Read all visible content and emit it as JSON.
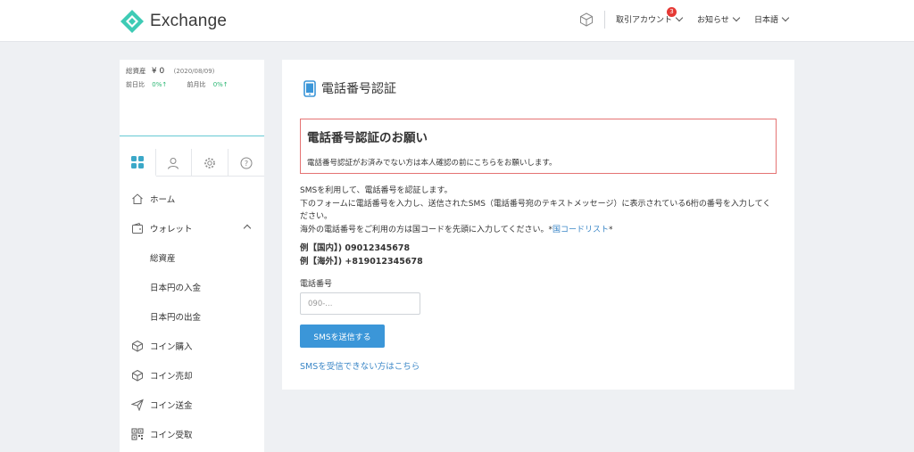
{
  "header": {
    "brand": "Exchange",
    "account_label": "取引アカウント",
    "account_badge": "3",
    "news_label": "お知らせ",
    "lang_label": "日本語",
    "accent": "#3ecbb5"
  },
  "sidebar": {
    "assets": {
      "total_label": "総資産",
      "total_value": "¥ 0",
      "date": "(2020/08/09)",
      "day_label": "前日比",
      "day_value": "0%↑",
      "month_label": "前月比",
      "month_value": "0%↑"
    },
    "tabs": [
      "dashboard-icon",
      "user-icon",
      "gear-icon",
      "help-icon"
    ],
    "items": [
      {
        "label": "ホーム",
        "icon": "home-icon"
      },
      {
        "label": "ウォレット",
        "icon": "wallet-icon"
      },
      {
        "label": "総資産"
      },
      {
        "label": "日本円の入金"
      },
      {
        "label": "日本円の出金"
      },
      {
        "label": "コイン購入",
        "icon": "cube-icon"
      },
      {
        "label": "コイン売却",
        "icon": "cube-icon"
      },
      {
        "label": "コイン送金",
        "icon": "send-icon"
      },
      {
        "label": "コイン受取",
        "icon": "qr-icon"
      }
    ]
  },
  "main": {
    "title": "電話番号認証",
    "notice_title": "電話番号認証のお願い",
    "notice_body": "電話番号認証がお済みでない方は本人確認の前にこちらをお願いします。",
    "desc_line1": "SMSを利用して、電話番号を認証します。",
    "desc_line2": "下のフォームに電話番号を入力し、送信されたSMS（電話番号宛のテキストメッセージ）に表示されている6桁の番号を入力してください。",
    "desc_line3_pre": "海外の電話番号をご利用の方は国コードを先頭に入力してください。*",
    "desc_link": "国コードリスト",
    "desc_line3_post": "*",
    "example_domestic": "例【国内】) 09012345678",
    "example_overseas": "例【海外】) +819012345678",
    "phone_label": "電話番号",
    "phone_placeholder": "090-...",
    "phone_value": "",
    "send_button": "SMSを送信する",
    "sms_help_link": "SMSを受信できない方はこちら"
  }
}
